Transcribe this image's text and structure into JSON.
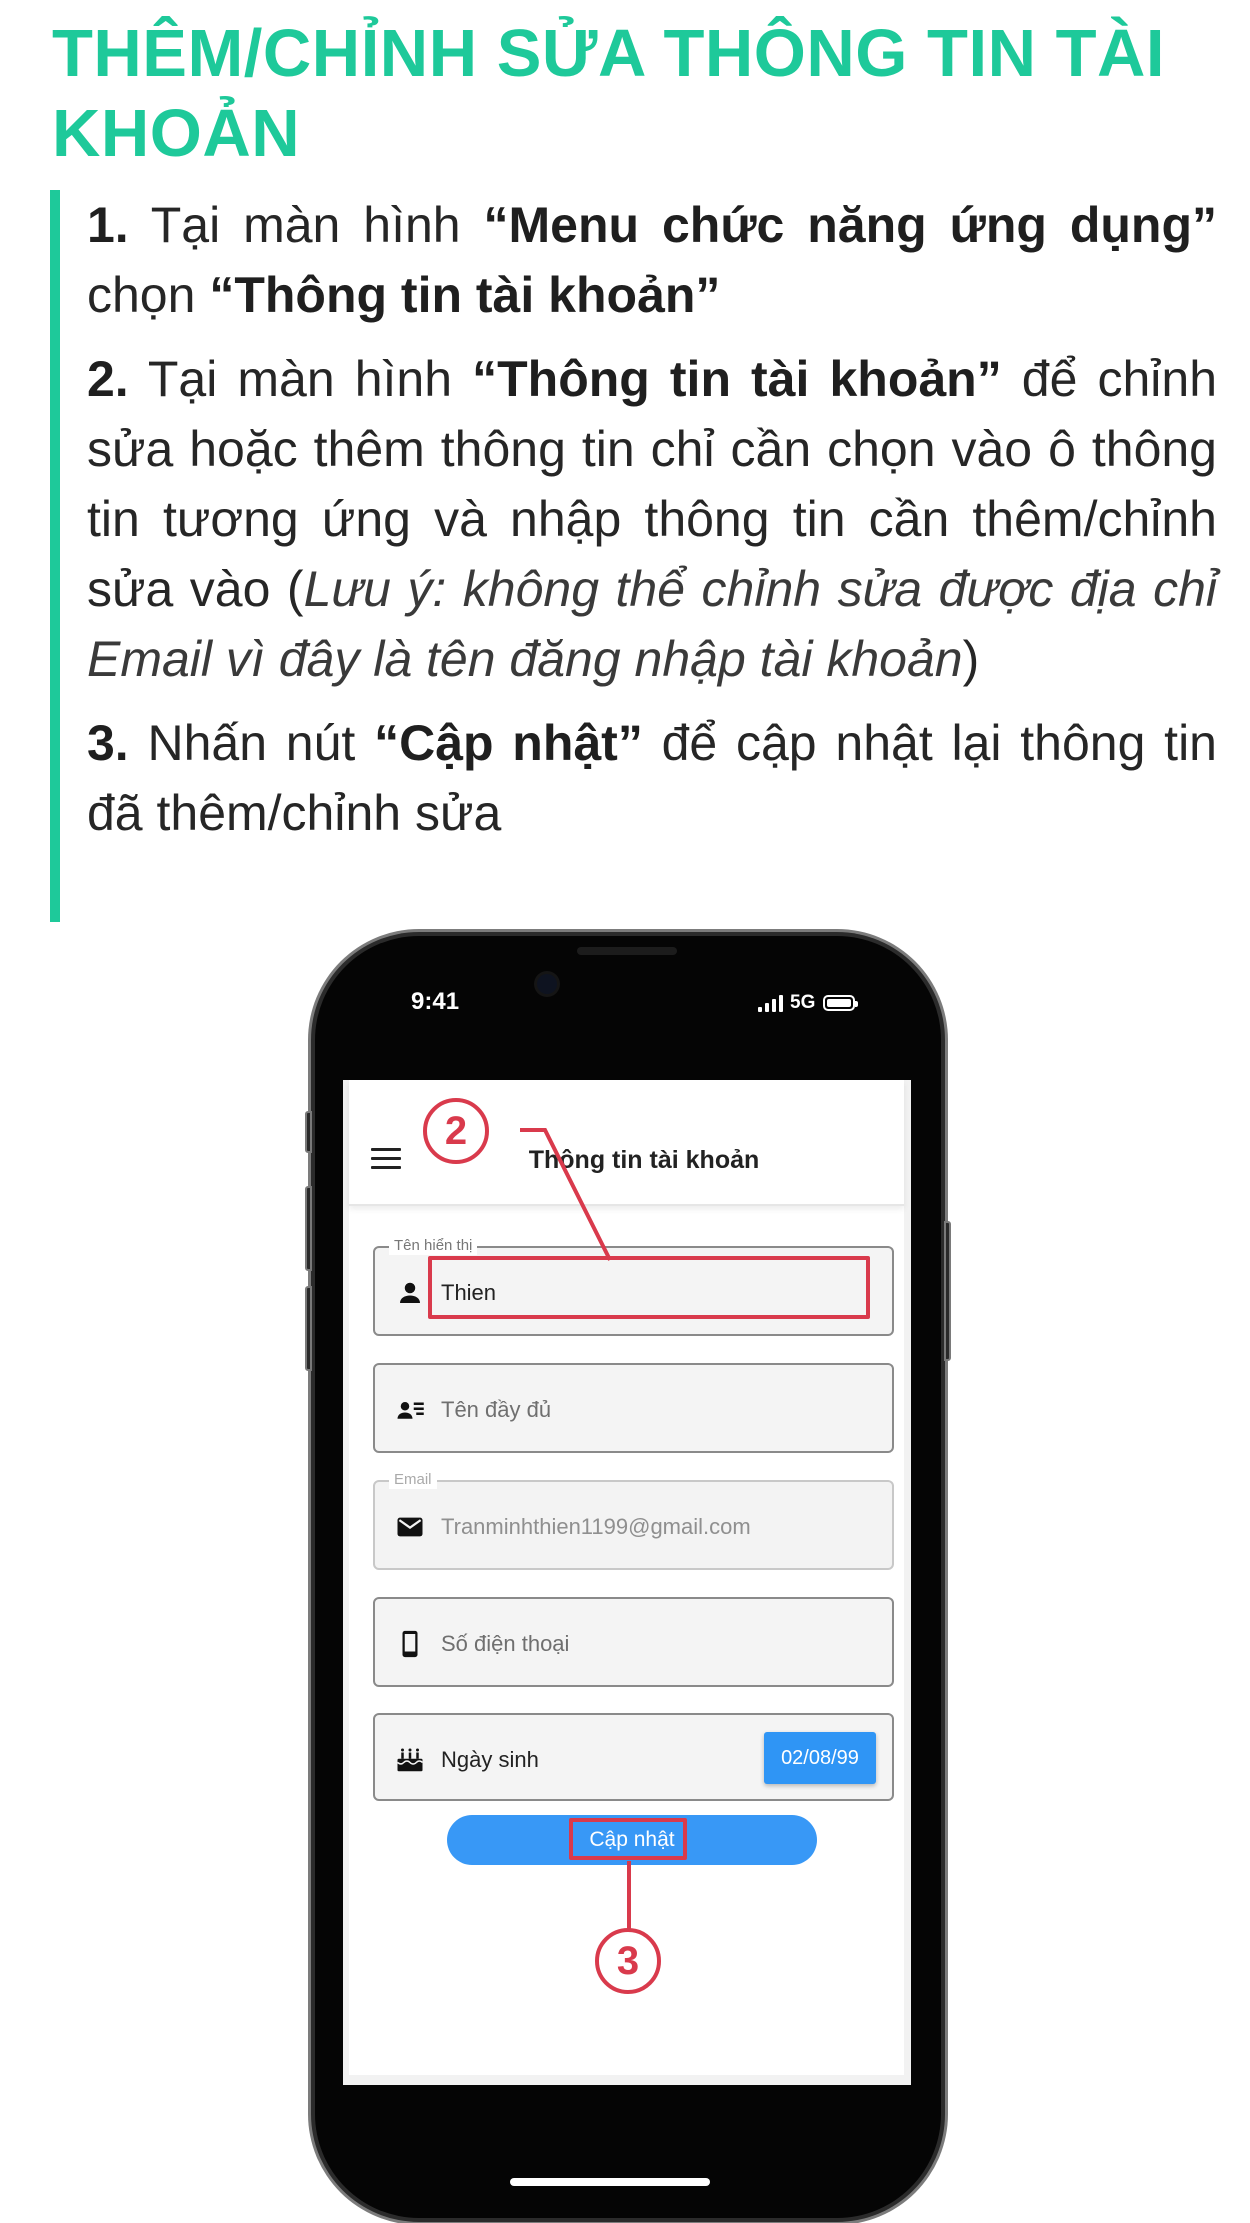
{
  "heading": "THÊM/CHỈNH SỬA THÔNG TIN TÀI KHOẢN",
  "steps": [
    {
      "parts": [
        {
          "t": "1.",
          "s": "b"
        },
        {
          "t": " Tại màn hình ",
          "s": "n"
        },
        {
          "t": "“Menu chức năng ứng dụng”",
          "s": "b"
        },
        {
          "t": " chọn ",
          "s": "n"
        },
        {
          "t": "“Thông tin tài khoản”",
          "s": "b"
        }
      ]
    },
    {
      "parts": [
        {
          "t": "2.",
          "s": "b"
        },
        {
          "t": " Tại màn hình ",
          "s": "n"
        },
        {
          "t": "“Thông tin tài khoản”",
          "s": "b"
        },
        {
          "t": " để chỉnh sửa hoặc thêm thông tin chỉ cần chọn vào ô thông tin tương ứng và nhập thông tin cần thêm/chỉnh sửa vào (",
          "s": "n"
        },
        {
          "t": "Lưu ý: không thể chỉnh sửa được địa chỉ Email vì đây là tên đăng nhập tài khoản",
          "s": "i"
        },
        {
          "t": ")",
          "s": "n"
        }
      ]
    },
    {
      "parts": [
        {
          "t": "3.",
          "s": "b"
        },
        {
          "t": " Nhấn nút ",
          "s": "n"
        },
        {
          "t": "“Cập nhật”",
          "s": "b"
        },
        {
          "t": " để cập nhật lại thông tin đã thêm/chỉnh sửa",
          "s": "n"
        }
      ]
    }
  ],
  "phone": {
    "status": {
      "time": "9:41",
      "network": "5G"
    },
    "app_bar": {
      "title": "Thông tin tài khoản",
      "menu_icon": "hamburger-menu-icon"
    },
    "fields": {
      "display_name": {
        "legend": "Tên hiển thị",
        "value": "Thien",
        "icon": "person-icon"
      },
      "full_name": {
        "placeholder": "Tên đầy đủ",
        "icon": "contact-card-icon"
      },
      "email": {
        "legend": "Email",
        "value": "Tranminhthien1199@gmail.com",
        "icon": "mail-icon"
      },
      "phone": {
        "placeholder": "Số điện thoại",
        "icon": "smartphone-icon"
      },
      "birthday": {
        "label": "Ngày sinh",
        "date": "02/08/99",
        "icon": "cake-icon"
      }
    },
    "update_button": "Cập nhật"
  },
  "annotations": {
    "marker_2": "2",
    "marker_3": "3",
    "color": "#d93a4c"
  },
  "colors": {
    "accent_green": "#1ec99a",
    "button_blue": "#3898f6"
  }
}
